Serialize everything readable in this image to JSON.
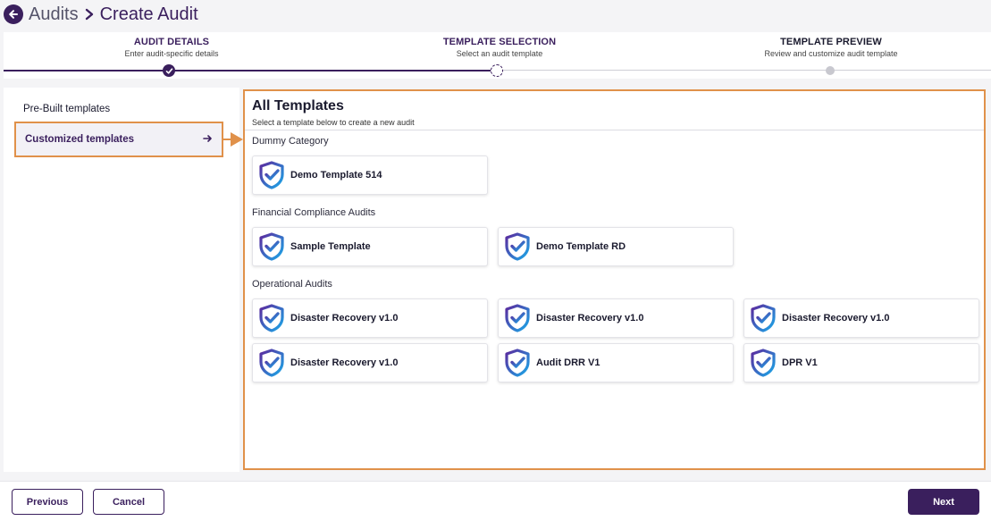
{
  "header": {
    "breadcrumb_root": "Audits",
    "breadcrumb_current": "Create Audit"
  },
  "stepper": {
    "steps": [
      {
        "title": "AUDIT DETAILS",
        "subtitle": "Enter audit-specific details",
        "status": "completed"
      },
      {
        "title": "TEMPLATE SELECTION",
        "subtitle": "Select an audit template",
        "status": "current"
      },
      {
        "title": "TEMPLATE PREVIEW",
        "subtitle": "Review and customize audit template",
        "status": "pending"
      }
    ]
  },
  "sidebar": {
    "items": [
      {
        "label": "Pre-Built templates",
        "selected": false
      },
      {
        "label": "Customized templates",
        "selected": true,
        "arrow": "→"
      }
    ]
  },
  "main": {
    "title": "All Templates",
    "subtitle": "Select a template below to create a new audit",
    "categories": [
      {
        "name": "Dummy Category",
        "templates": [
          "Demo Template 514"
        ]
      },
      {
        "name": "Financial Compliance Audits",
        "templates": [
          "Sample Template",
          "Demo Template RD"
        ]
      },
      {
        "name": "Operational Audits",
        "templates": [
          "Disaster Recovery v1.0",
          "Disaster Recovery v1.0",
          "Disaster Recovery v1.0",
          "Disaster Recovery v1.0",
          "Audit DRR V1",
          "DPR V1"
        ]
      }
    ]
  },
  "footer": {
    "previous_label": "Previous",
    "cancel_label": "Cancel",
    "next_label": "Next"
  },
  "colors": {
    "brand": "#3a1f5d",
    "highlight": "#e0914a",
    "logo_gradient_start": "#5b2a9e",
    "logo_gradient_end": "#1aa8e8"
  },
  "icons": [
    "back-arrow-icon",
    "chevron-right-icon",
    "check-icon",
    "arrow-right-icon",
    "shield-check-icon"
  ]
}
